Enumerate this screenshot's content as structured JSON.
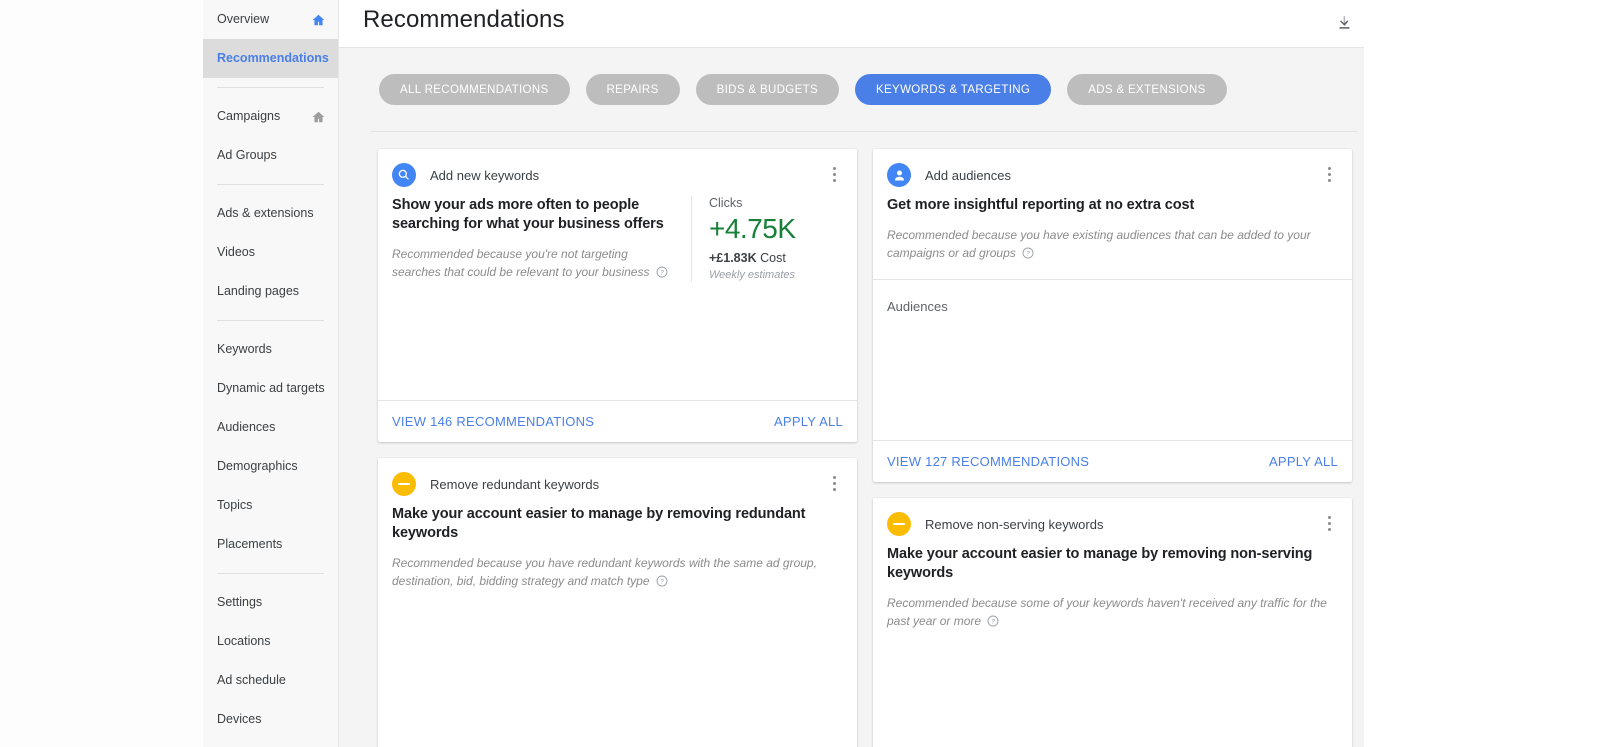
{
  "sidebar": {
    "items": [
      {
        "label": "Overview",
        "icon": "home-icon",
        "icon_color": "#4285f4",
        "active": false
      },
      {
        "label": "Recommendations",
        "icon": null,
        "active": true
      },
      {
        "sep": true
      },
      {
        "label": "Campaigns",
        "icon": "home-icon",
        "icon_color": "#9e9e9e",
        "active": false
      },
      {
        "label": "Ad Groups",
        "icon": null,
        "active": false
      },
      {
        "sep": true
      },
      {
        "label": "Ads & extensions",
        "icon": null,
        "active": false
      },
      {
        "label": "Videos",
        "icon": null,
        "active": false
      },
      {
        "label": "Landing pages",
        "icon": null,
        "active": false
      },
      {
        "sep": true
      },
      {
        "label": "Keywords",
        "icon": null,
        "active": false
      },
      {
        "label": "Dynamic ad targets",
        "icon": null,
        "active": false
      },
      {
        "label": "Audiences",
        "icon": null,
        "active": false
      },
      {
        "label": "Demographics",
        "icon": null,
        "active": false
      },
      {
        "label": "Topics",
        "icon": null,
        "active": false
      },
      {
        "label": "Placements",
        "icon": null,
        "active": false
      },
      {
        "sep": true
      },
      {
        "label": "Settings",
        "icon": null,
        "active": false
      },
      {
        "label": "Locations",
        "icon": null,
        "active": false
      },
      {
        "label": "Ad schedule",
        "icon": null,
        "active": false
      },
      {
        "label": "Devices",
        "icon": null,
        "active": false
      }
    ]
  },
  "header": {
    "title": "Recommendations",
    "download_icon": "download-icon"
  },
  "filters": {
    "chips": [
      {
        "label": "ALL RECOMMENDATIONS",
        "active": false
      },
      {
        "label": "REPAIRS",
        "active": false
      },
      {
        "label": "BIDS & BUDGETS",
        "active": false
      },
      {
        "label": "KEYWORDS & TARGETING",
        "active": true
      },
      {
        "label": "ADS & EXTENSIONS",
        "active": false
      }
    ],
    "active_color": "#4a7fe8",
    "inactive_color": "#bdbdbd"
  },
  "cards": {
    "add_new_keywords": {
      "icon": "search-icon",
      "icon_color": "#4285f4",
      "kind": "Add new keywords",
      "title": "Show your ads more often to people searching for what your business offers",
      "reason": "Recommended because you're not targeting searches that could be relevant to your business",
      "metric_label": "Clicks",
      "metric_value": "+4.75K",
      "metric_value_color": "#188038",
      "metric_sub_strong": "+£1.83K",
      "metric_sub_rest": "Cost",
      "metric_note": "Weekly estimates",
      "view_link": "VIEW 146 RECOMMENDATIONS",
      "apply_link": "APPLY ALL"
    },
    "add_audiences": {
      "icon": "person-icon",
      "icon_color": "#4285f4",
      "kind": "Add audiences",
      "title": "Get more insightful reporting at no extra cost",
      "reason": "Recommended because you have existing audiences that can be added to your campaigns or ad groups",
      "section_label": "Audiences",
      "view_link": "VIEW 127 RECOMMENDATIONS",
      "apply_link": "APPLY ALL"
    },
    "remove_redundant_keywords": {
      "icon": "minus-circle-icon",
      "icon_color": "#fbbc04",
      "kind": "Remove redundant keywords",
      "title": "Make your account easier to manage by removing redundant keywords",
      "reason": "Recommended because you have redundant keywords with the same ad group, destination, bid, bidding strategy and match type"
    },
    "remove_non_serving_keywords": {
      "icon": "minus-circle-icon",
      "icon_color": "#fbbc04",
      "kind": "Remove non-serving keywords",
      "title": "Make your account easier to manage by removing non-serving keywords",
      "reason": "Recommended because some of your keywords haven't received any traffic for the past year or more"
    }
  }
}
